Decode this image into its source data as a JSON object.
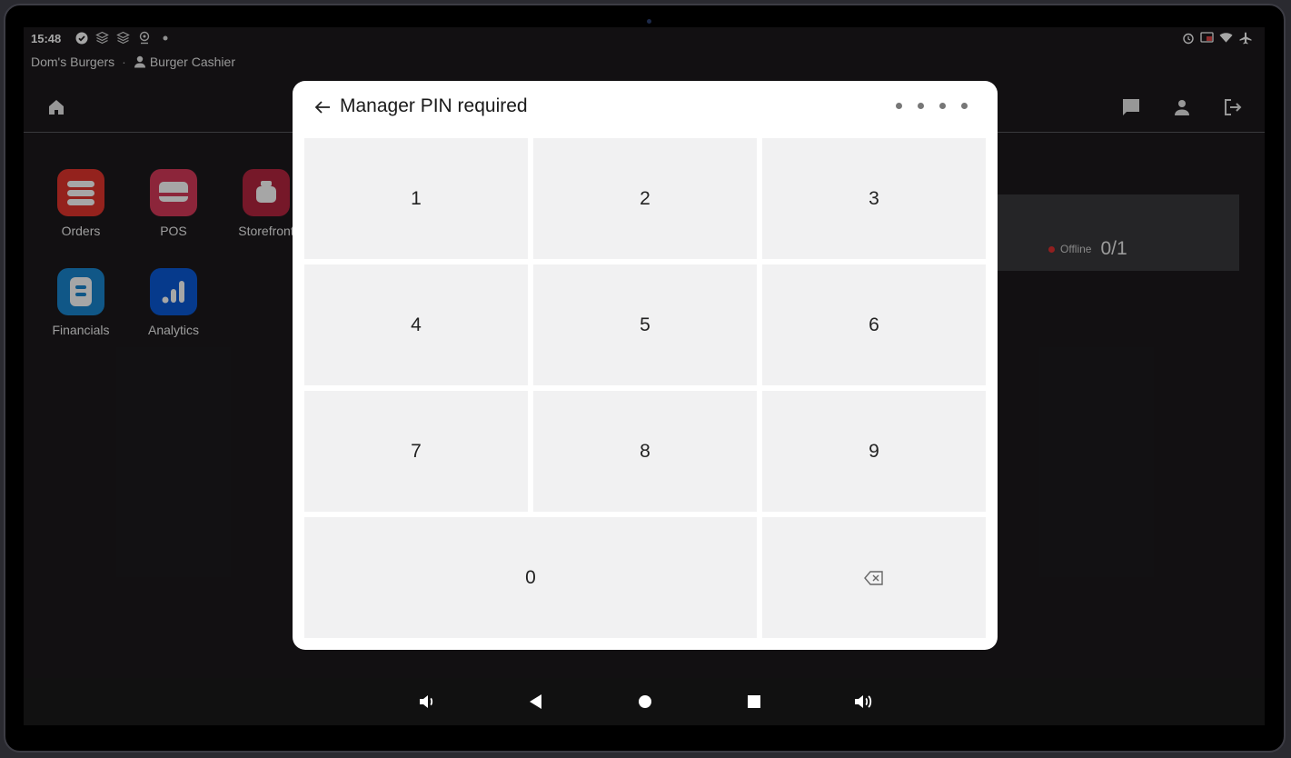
{
  "status_bar": {
    "time": "15:48",
    "left_icons": [
      "check-circle-icon",
      "stack-icon",
      "stack-icon",
      "location-icon",
      "dot-icon"
    ],
    "right_icons": [
      "alarm-icon",
      "cast-icon",
      "wifi-icon",
      "airplane-icon"
    ]
  },
  "business": {
    "name": "Dom's Burgers",
    "separator": "·",
    "user": "Burger Cashier"
  },
  "header": {
    "icons": [
      "home-icon",
      "chat-icon",
      "person-icon",
      "logout-icon"
    ]
  },
  "apps": [
    {
      "label": "Orders",
      "icon": "orders-icon",
      "color": "#e3352d"
    },
    {
      "label": "POS",
      "icon": "pos-icon",
      "color": "#d8395a"
    },
    {
      "label": "Storefront",
      "icon": "storefront-icon",
      "color": "#b5253f"
    },
    {
      "label": "Financials",
      "icon": "financials-icon",
      "color": "#1a86d0"
    },
    {
      "label": "Analytics",
      "icon": "analytics-icon",
      "color": "#0a5ad8"
    }
  ],
  "background_card": {
    "status": "Offline",
    "count": "0/1",
    "status_color": "#e03030"
  },
  "modal": {
    "title": "Manager PIN required",
    "pin_length": 4,
    "pin_entered": 0,
    "keys": [
      "1",
      "2",
      "3",
      "4",
      "5",
      "6",
      "7",
      "8",
      "9",
      "0"
    ],
    "backspace_icon": "backspace-icon"
  },
  "nav_bar": {
    "icons": [
      "volume-down-icon",
      "back-icon",
      "home-circle-icon",
      "recents-icon",
      "volume-up-icon"
    ]
  }
}
